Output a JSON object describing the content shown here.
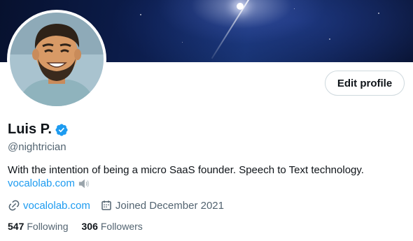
{
  "profile": {
    "name": "Luis P.",
    "handle": "@nightrician",
    "verified": true,
    "bio": "With the intention of being a micro SaaS founder. Speech to Text technology.",
    "bio_link": "vocalolab.com",
    "bio_link_emoji": "speaker-icon",
    "website": "vocalolab.com",
    "joined": "Joined December 2021",
    "following_count": "547",
    "following_label": "Following",
    "followers_count": "306",
    "followers_label": "Followers"
  },
  "actions": {
    "edit_profile_label": "Edit profile"
  },
  "colors": {
    "accent": "#1d9bf0",
    "text_primary": "#0f1419",
    "text_secondary": "#536471",
    "border": "#cfd9de"
  },
  "icons": [
    "verified-badge-icon",
    "speaker-icon",
    "link-icon",
    "calendar-icon"
  ]
}
